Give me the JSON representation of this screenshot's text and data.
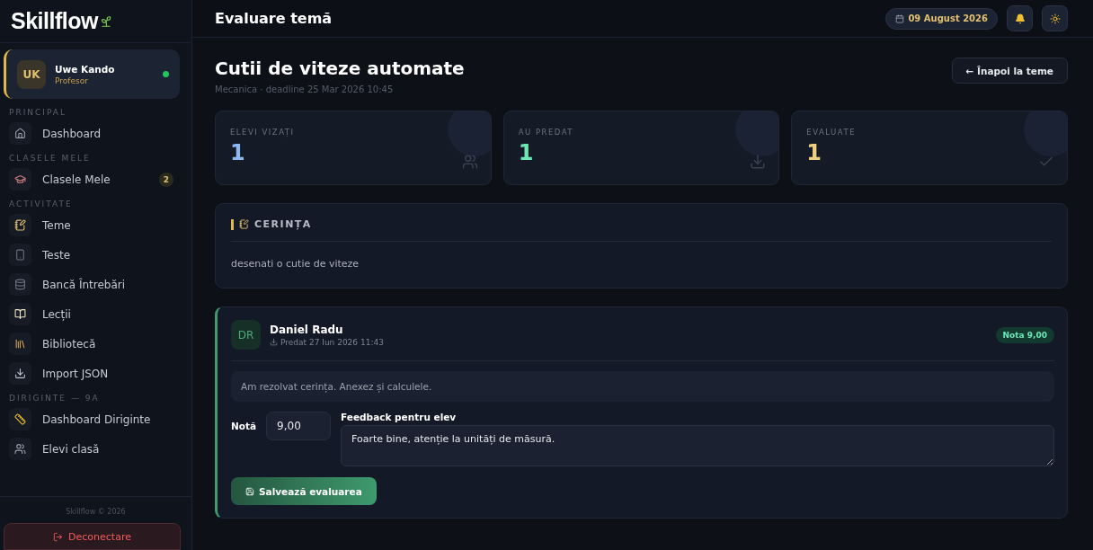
{
  "sidebar": {
    "logo": "Skillflow",
    "user": {
      "initials": "UK",
      "name": "Uwe Kando",
      "role": "Profesor",
      "online": true
    },
    "sections": [
      {
        "title": "PRINCIPAL",
        "items": [
          {
            "label": "Dashboard"
          }
        ]
      },
      {
        "title": "CLASELE MELE",
        "items": [
          {
            "label": "Clasele Mele",
            "badge": "2"
          }
        ]
      },
      {
        "title": "ACTIVITATE",
        "items": [
          {
            "label": "Teme"
          },
          {
            "label": "Teste"
          },
          {
            "label": "Bancă Întrebări"
          },
          {
            "label": "Lecții"
          },
          {
            "label": "Bibliotecă"
          },
          {
            "label": "Import JSON"
          }
        ]
      },
      {
        "title": "DIRIGINTE — 9A",
        "items": [
          {
            "label": "Dashboard Diriginte"
          },
          {
            "label": "Elevi clasă"
          }
        ]
      }
    ],
    "footer": "Skillflow © 2026",
    "logout": "Deconectare"
  },
  "header": {
    "title": "Evaluare temă",
    "date": "09 August 2026"
  },
  "page": {
    "title": "Cutii de viteze automate",
    "subtitle": "Mecanica · deadline 25 Mar 2026 10:45",
    "back": "← Înapoi la teme"
  },
  "stats": [
    {
      "label": "ELEVI VIZAȚI",
      "value": "1",
      "color": "#8fb8f0"
    },
    {
      "label": "AU PREDAT",
      "value": "1",
      "color": "#6ee7b7"
    },
    {
      "label": "EVALUATE",
      "value": "1",
      "color": "#f0d080"
    }
  ],
  "requirement": {
    "title": "CERINȚA",
    "text": "desenati o cutie de viteze"
  },
  "submission": {
    "initials": "DR",
    "name": "Daniel Radu",
    "submitted": "Predat 27 Iun 2026 11:43",
    "grade_badge": "Nota 9,00",
    "answer": "Am rezolvat cerința. Anexez și calculele.",
    "grade_label": "Notă",
    "grade": "9,00",
    "feedback_label": "Feedback pentru elev",
    "feedback": "Foarte bine, atenție la unități de măsură.",
    "save": "Salvează evaluarea"
  }
}
